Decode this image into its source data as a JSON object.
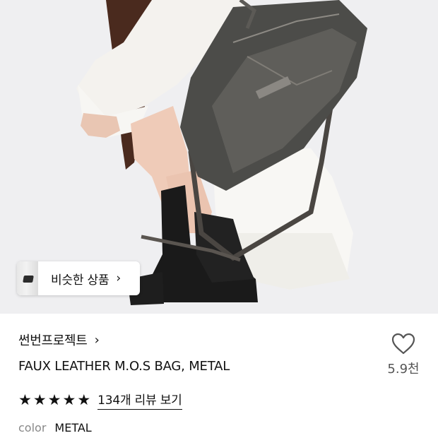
{
  "similar_products": {
    "label": "비슷한 상품",
    "chevron": "›"
  },
  "product": {
    "brand": "썬번프로젝트",
    "brand_chevron": "›",
    "title": "FAUX LEATHER M.O.S BAG, METAL",
    "like_count": "5.9천",
    "rating_stars": 5,
    "review_link": "134개 리뷰 보기",
    "color_label": "color",
    "color_value": "METAL"
  },
  "icons": {
    "like": "heart-outline-icon",
    "star": "star-filled-icon",
    "chevron": "chevron-right-icon"
  }
}
